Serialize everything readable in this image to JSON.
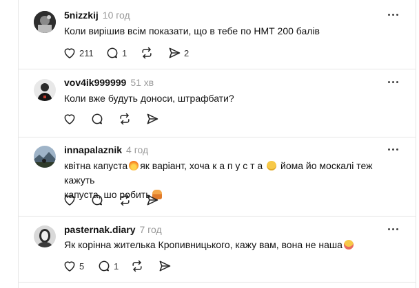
{
  "posts": [
    {
      "username": "5nizzkij",
      "time": "10 год",
      "text": "Коли вирішив всім показати, що в тебе по НМТ 200 балів",
      "likes": "211",
      "replies": "1",
      "shares": "2"
    },
    {
      "username": "vov4ik999999",
      "time": "51 хв",
      "text": "Коли вже будуть доноси, штрафбати?"
    },
    {
      "username": "innapalaznik",
      "time": "4 год",
      "text_part1": "квітна капуста",
      "text_part2": "як варіант, хоча к а п у с т а",
      "text_part3": "йома йо москалі теж кажуть",
      "text_line2": "капуста, шо робить"
    },
    {
      "username": "pasternak.diary",
      "time": "7 год",
      "text": "Як корінна жителька Кропивницького, кажу вам, вона не наша",
      "likes": "5",
      "replies": "1"
    }
  ],
  "icons": {
    "like": "heart-icon",
    "reply": "comment-icon",
    "repost": "repost-icon",
    "share": "send-icon",
    "more": "more-icon"
  },
  "colors": {
    "text": "#101010",
    "muted": "#9a9a9a",
    "divider": "#e4e4e4"
  }
}
